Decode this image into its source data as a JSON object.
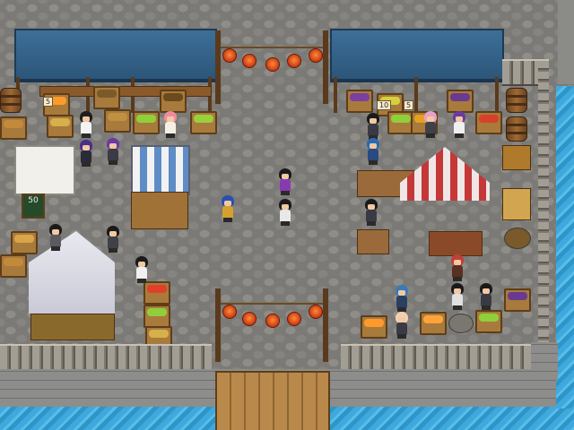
{
  "scene": {
    "type": "RPG town market",
    "tiles": {
      "cobblestone": "#7b7a76",
      "awning_blue": "#2f5c82",
      "wood": "#8a5a2b",
      "water": "#3fa9de",
      "lantern": "#e0561f"
    }
  },
  "signs": {
    "price_left_5": "5",
    "price_right_10": "10",
    "price_right_5": "5",
    "chalkboard": "50"
  },
  "player": {
    "name_hidden": true,
    "hair_color": "#2a4fb0"
  },
  "icons": {
    "lantern": "lantern-icon",
    "crate": "produce-crate-icon",
    "barrel": "barrel-icon",
    "fish": "fish-icon"
  }
}
